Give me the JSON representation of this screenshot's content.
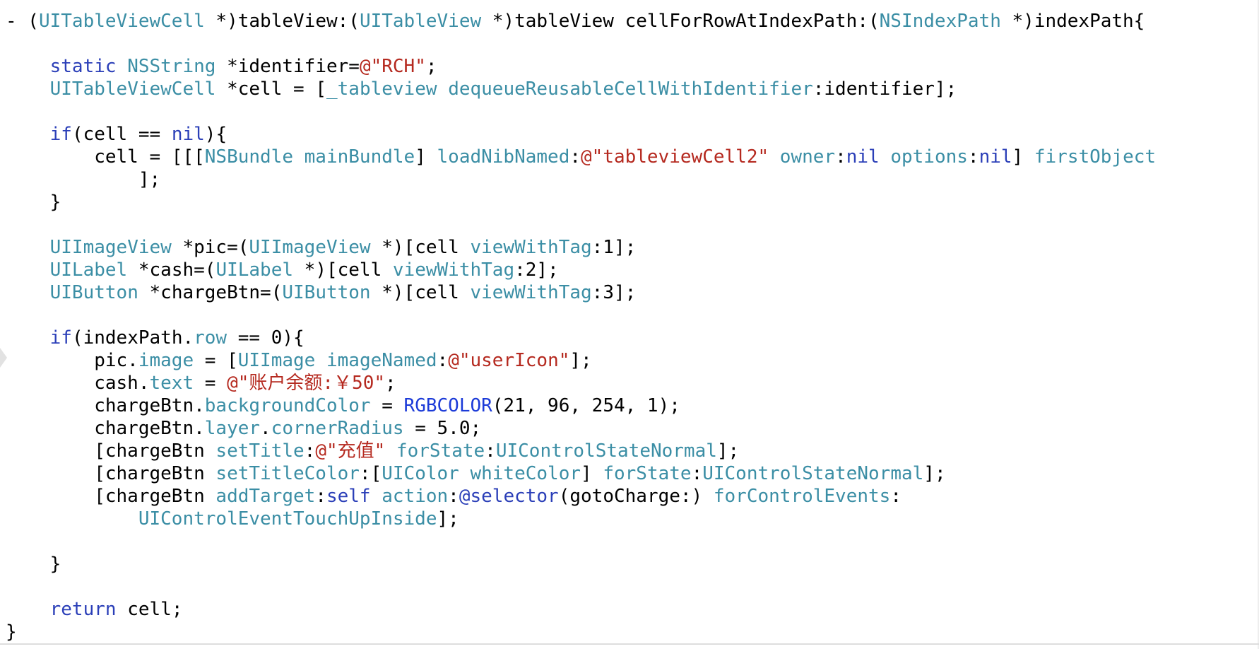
{
  "colors": {
    "background": "#ffffff",
    "keyword": "#2b3fb8",
    "type": "#3b8ea5",
    "method": "#3b8ea5",
    "string": "#b5291f",
    "macro": "#1c3bd8",
    "plain": "#000000"
  },
  "code_lines": [
    [
      [
        "plain",
        "- ("
      ],
      [
        "type",
        "UITableViewCell"
      ],
      [
        "plain",
        " *)tableView:("
      ],
      [
        "type",
        "UITableView"
      ],
      [
        "plain",
        " *)tableView cellForRowAtIndexPath:("
      ],
      [
        "type",
        "NSIndexPath"
      ],
      [
        "plain",
        " *)indexPath{"
      ]
    ],
    [],
    [
      [
        "plain",
        "    "
      ],
      [
        "keyword",
        "static"
      ],
      [
        "plain",
        " "
      ],
      [
        "type",
        "NSString"
      ],
      [
        "plain",
        " *identifier="
      ],
      [
        "string",
        "@\"RCH\""
      ],
      [
        "plain",
        ";"
      ]
    ],
    [
      [
        "plain",
        "    "
      ],
      [
        "type",
        "UITableViewCell"
      ],
      [
        "plain",
        " *cell = ["
      ],
      [
        "method",
        "_tableview"
      ],
      [
        "plain",
        " "
      ],
      [
        "method",
        "dequeueReusableCellWithIdentifier"
      ],
      [
        "plain",
        ":identifier];"
      ]
    ],
    [],
    [
      [
        "plain",
        "    "
      ],
      [
        "keyword",
        "if"
      ],
      [
        "plain",
        "(cell == "
      ],
      [
        "keyword",
        "nil"
      ],
      [
        "plain",
        "){"
      ]
    ],
    [
      [
        "plain",
        "        cell = [[["
      ],
      [
        "type",
        "NSBundle"
      ],
      [
        "plain",
        " "
      ],
      [
        "method",
        "mainBundle"
      ],
      [
        "plain",
        "] "
      ],
      [
        "method",
        "loadNibNamed"
      ],
      [
        "plain",
        ":"
      ],
      [
        "string",
        "@\"tableviewCell2\""
      ],
      [
        "plain",
        " "
      ],
      [
        "method",
        "owner"
      ],
      [
        "plain",
        ":"
      ],
      [
        "keyword",
        "nil"
      ],
      [
        "plain",
        " "
      ],
      [
        "method",
        "options"
      ],
      [
        "plain",
        ":"
      ],
      [
        "keyword",
        "nil"
      ],
      [
        "plain",
        "] "
      ],
      [
        "method",
        "firstObject"
      ]
    ],
    [
      [
        "plain",
        "            ];"
      ]
    ],
    [
      [
        "plain",
        "    }"
      ]
    ],
    [],
    [
      [
        "plain",
        "    "
      ],
      [
        "type",
        "UIImageView"
      ],
      [
        "plain",
        " *pic=("
      ],
      [
        "type",
        "UIImageView"
      ],
      [
        "plain",
        " *)[cell "
      ],
      [
        "method",
        "viewWithTag"
      ],
      [
        "plain",
        ":1];"
      ]
    ],
    [
      [
        "plain",
        "    "
      ],
      [
        "type",
        "UILabel"
      ],
      [
        "plain",
        " *cash=("
      ],
      [
        "type",
        "UILabel"
      ],
      [
        "plain",
        " *)[cell "
      ],
      [
        "method",
        "viewWithTag"
      ],
      [
        "plain",
        ":2];"
      ]
    ],
    [
      [
        "plain",
        "    "
      ],
      [
        "type",
        "UIButton"
      ],
      [
        "plain",
        " *chargeBtn=("
      ],
      [
        "type",
        "UIButton"
      ],
      [
        "plain",
        " *)[cell "
      ],
      [
        "method",
        "viewWithTag"
      ],
      [
        "plain",
        ":3];"
      ]
    ],
    [],
    [
      [
        "plain",
        "    "
      ],
      [
        "keyword",
        "if"
      ],
      [
        "plain",
        "(indexPath."
      ],
      [
        "method",
        "row"
      ],
      [
        "plain",
        " == 0){"
      ]
    ],
    [
      [
        "plain",
        "        pic."
      ],
      [
        "method",
        "image"
      ],
      [
        "plain",
        " = ["
      ],
      [
        "type",
        "UIImage"
      ],
      [
        "plain",
        " "
      ],
      [
        "method",
        "imageNamed"
      ],
      [
        "plain",
        ":"
      ],
      [
        "string",
        "@\"userIcon\""
      ],
      [
        "plain",
        "];"
      ]
    ],
    [
      [
        "plain",
        "        cash."
      ],
      [
        "method",
        "text"
      ],
      [
        "plain",
        " = "
      ],
      [
        "string",
        "@\"账户余额:￥50\""
      ],
      [
        "plain",
        ";"
      ]
    ],
    [
      [
        "plain",
        "        chargeBtn."
      ],
      [
        "method",
        "backgroundColor"
      ],
      [
        "plain",
        " = "
      ],
      [
        "macro",
        "RGBCOLOR"
      ],
      [
        "plain",
        "(21, 96, 254, 1);"
      ]
    ],
    [
      [
        "plain",
        "        chargeBtn."
      ],
      [
        "method",
        "layer"
      ],
      [
        "plain",
        "."
      ],
      [
        "method",
        "cornerRadius"
      ],
      [
        "plain",
        " = 5.0;"
      ]
    ],
    [
      [
        "plain",
        "        [chargeBtn "
      ],
      [
        "method",
        "setTitle"
      ],
      [
        "plain",
        ":"
      ],
      [
        "string",
        "@\"充值\""
      ],
      [
        "plain",
        " "
      ],
      [
        "method",
        "forState"
      ],
      [
        "plain",
        ":"
      ],
      [
        "type",
        "UIControlStateNormal"
      ],
      [
        "plain",
        "];"
      ]
    ],
    [
      [
        "plain",
        "        [chargeBtn "
      ],
      [
        "method",
        "setTitleColor"
      ],
      [
        "plain",
        ":["
      ],
      [
        "type",
        "UIColor"
      ],
      [
        "plain",
        " "
      ],
      [
        "method",
        "whiteColor"
      ],
      [
        "plain",
        "] "
      ],
      [
        "method",
        "forState"
      ],
      [
        "plain",
        ":"
      ],
      [
        "type",
        "UIControlStateNormal"
      ],
      [
        "plain",
        "];"
      ]
    ],
    [
      [
        "plain",
        "        [chargeBtn "
      ],
      [
        "method",
        "addTarget"
      ],
      [
        "plain",
        ":"
      ],
      [
        "keyword",
        "self"
      ],
      [
        "plain",
        " "
      ],
      [
        "method",
        "action"
      ],
      [
        "plain",
        ":"
      ],
      [
        "keyword",
        "@selector"
      ],
      [
        "plain",
        "(gotoCharge:) "
      ],
      [
        "method",
        "forControlEvents"
      ],
      [
        "plain",
        ":"
      ]
    ],
    [
      [
        "plain",
        "            "
      ],
      [
        "type",
        "UIControlEventTouchUpInside"
      ],
      [
        "plain",
        "];"
      ]
    ],
    [],
    [
      [
        "plain",
        "    }"
      ]
    ],
    [],
    [
      [
        "plain",
        "    "
      ],
      [
        "keyword",
        "return"
      ],
      [
        "plain",
        " cell;"
      ]
    ],
    [
      [
        "plain",
        "}"
      ]
    ]
  ]
}
